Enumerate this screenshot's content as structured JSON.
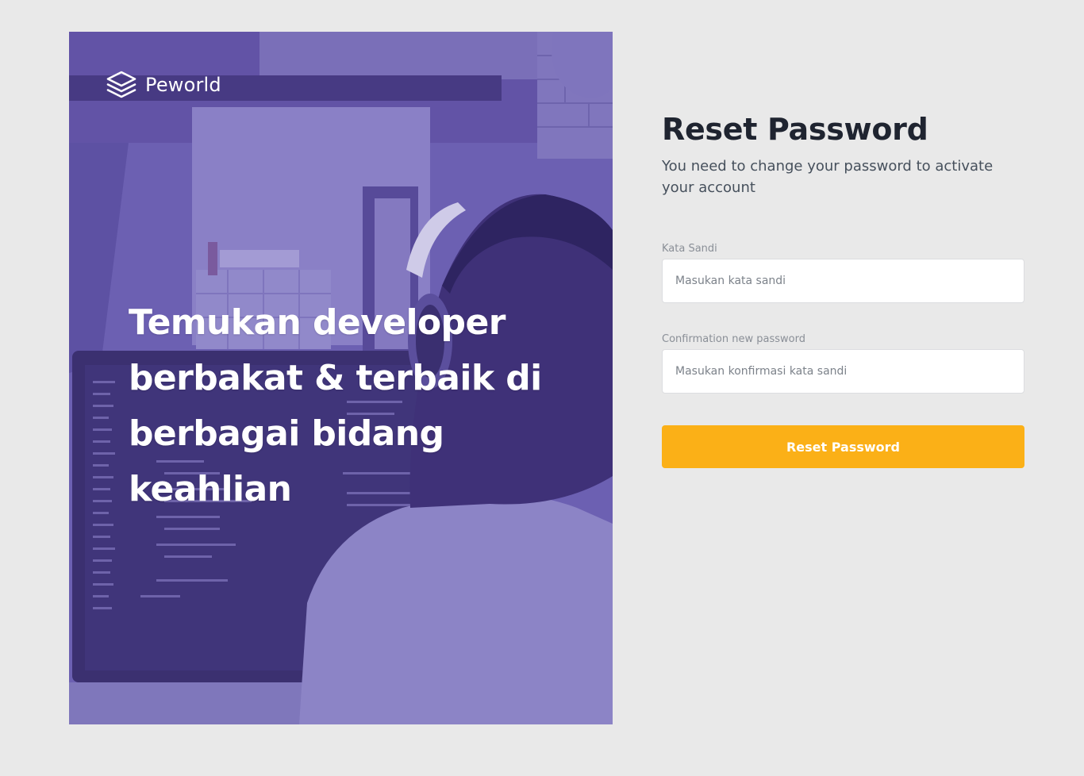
{
  "brand": {
    "name": "Peworld",
    "icon": "layers-icon"
  },
  "hero": {
    "headline_line1": "Temukan developer",
    "headline_line2": "berbakat & terbaik di",
    "headline_line3": "berbagai bidang keahlian",
    "overlay_color": "#6b5fb0"
  },
  "form": {
    "title": "Reset Password",
    "subtitle": "You need to change your password to activate your account",
    "password": {
      "label": "Kata Sandi",
      "placeholder": "Masukan kata sandi",
      "value": ""
    },
    "confirm": {
      "label": "Confirmation new password",
      "placeholder": "Masukan konfirmasi kata sandi",
      "value": ""
    },
    "submit_label": "Reset Password"
  },
  "colors": {
    "background": "#e9e9e9",
    "accent": "#fbb017",
    "title_text": "#1f2430"
  }
}
